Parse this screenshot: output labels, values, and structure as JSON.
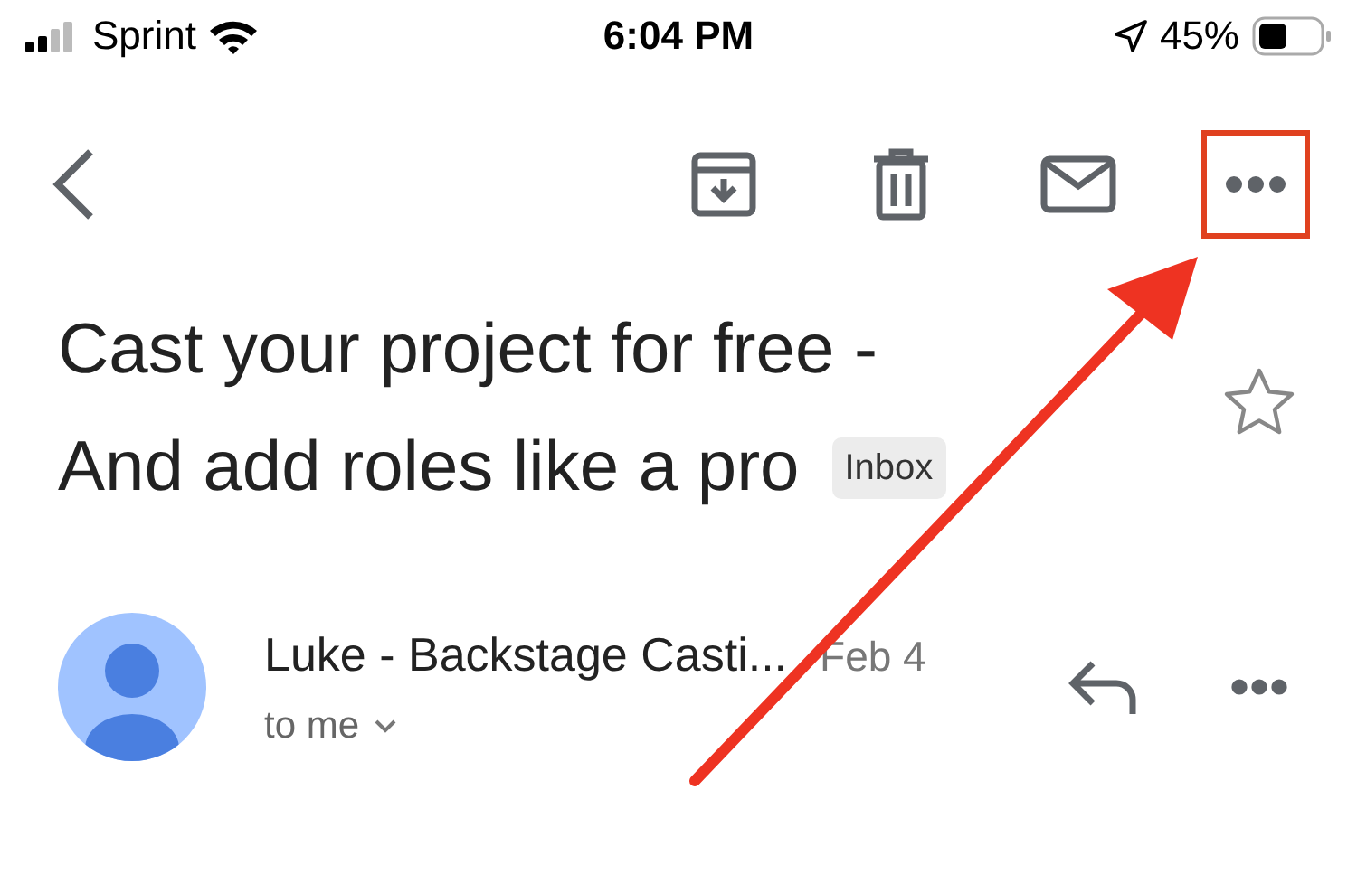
{
  "status_bar": {
    "carrier": "Sprint",
    "time": "6:04 PM",
    "battery": "45%"
  },
  "toolbar": {
    "actions": [
      {
        "kind": "archive",
        "highlighted": false
      },
      {
        "kind": "delete",
        "highlighted": false
      },
      {
        "kind": "unread",
        "highlighted": false
      },
      {
        "kind": "more",
        "highlighted": true
      }
    ]
  },
  "subject": {
    "lines": [
      "Cast your project for free -",
      "And add roles like a pro"
    ],
    "label": "Inbox",
    "starred": false
  },
  "message": {
    "sender": "Luke - Backstage Casti...",
    "date": "Feb 4",
    "recipient": "to me"
  },
  "annotations": [
    {
      "kind": "arrow"
    }
  ]
}
